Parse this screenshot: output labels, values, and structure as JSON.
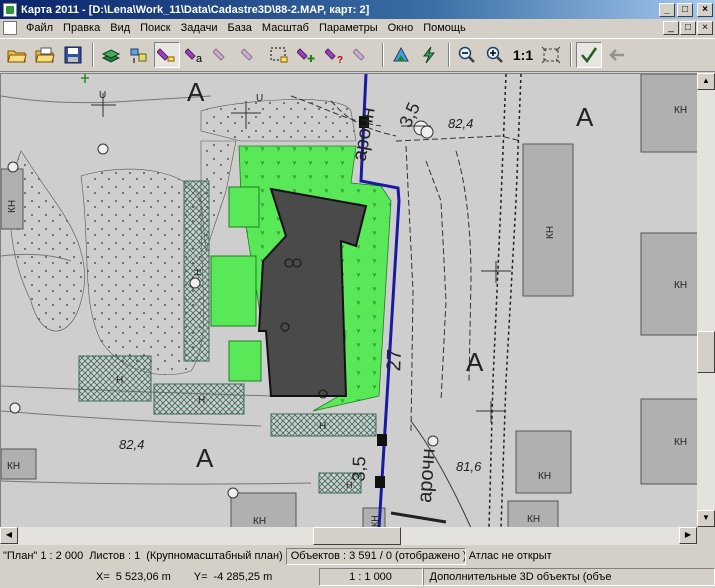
{
  "window": {
    "title": "Карта 2011 - [D:\\Lena\\Work_11\\Data\\Cadastre3D\\88-2.MAP, карт: 2]",
    "buttons": {
      "minimize": "_",
      "maximize": "□",
      "close": "×"
    }
  },
  "menu": [
    "Файл",
    "Правка",
    "Вид",
    "Поиск",
    "Задачи",
    "База",
    "Масштаб",
    "Параметры",
    "Окно",
    "Помощь"
  ],
  "toolbar": {
    "items": [
      {
        "name": "open-icon",
        "glyph": "📂"
      },
      {
        "name": "open-multiple-icon",
        "glyph": "📂"
      },
      {
        "name": "save-icon",
        "glyph": "💾"
      },
      {
        "name": "layers-icon",
        "glyph": "≡"
      },
      {
        "name": "select-objects-icon",
        "glyph": "▦"
      },
      {
        "name": "flashlight-icon",
        "glyph": "✎"
      },
      {
        "name": "flashlight-text-icon",
        "glyph": "a"
      },
      {
        "name": "flashlight-disabled-icon",
        "glyph": "✎"
      },
      {
        "name": "flashlight-disabled-2-icon",
        "glyph": "✎"
      },
      {
        "name": "select-frame-icon",
        "glyph": "⬚"
      },
      {
        "name": "flashlight-add-icon",
        "glyph": "+"
      },
      {
        "name": "flashlight-query-icon",
        "glyph": "?"
      },
      {
        "name": "flashlight-remove-icon",
        "glyph": "✎"
      },
      {
        "name": "cadastre-icon",
        "glyph": "▲"
      },
      {
        "name": "lightning-icon",
        "glyph": "⚡"
      },
      {
        "name": "zoom-out-icon",
        "glyph": "−"
      },
      {
        "name": "zoom-in-icon",
        "glyph": "+"
      },
      {
        "name": "frame-zoom-icon",
        "glyph": "⬚"
      },
      {
        "name": "check-icon",
        "glyph": "✓"
      },
      {
        "name": "back-arrow-icon",
        "glyph": "←"
      }
    ],
    "scale_label": "1:1"
  },
  "map": {
    "labels": {
      "a_top_left": "А",
      "a_right": "А",
      "a_middle": "А",
      "a_bottom_left": "А",
      "height_top": "82,4",
      "height_left": "82,4",
      "height_bottom": "81,6",
      "num_27": "27",
      "archway_top": "арочн",
      "archway_bottom": "арочн",
      "dim_top": "3,5",
      "dim_bottom": "3,5",
      "u_top1": "U",
      "u_top2": "U",
      "kn": "КН",
      "n": "Н"
    }
  },
  "status": {
    "plan": "\"План\"  1 : 2 000",
    "sheets": "Листов : 1",
    "plan_type": "(Крупномасштабный план)",
    "objects": "Объектов : 3 591 / 0 (отображено )",
    "atlas": "Атлас не открыт",
    "x_label": "X=",
    "x_value": "5 523,06 m",
    "y_label": "Y=",
    "y_value": "-4 285,25 m",
    "scale": "1 : 1 000",
    "extra": "Дополнительные 3D объекты  (объе"
  }
}
